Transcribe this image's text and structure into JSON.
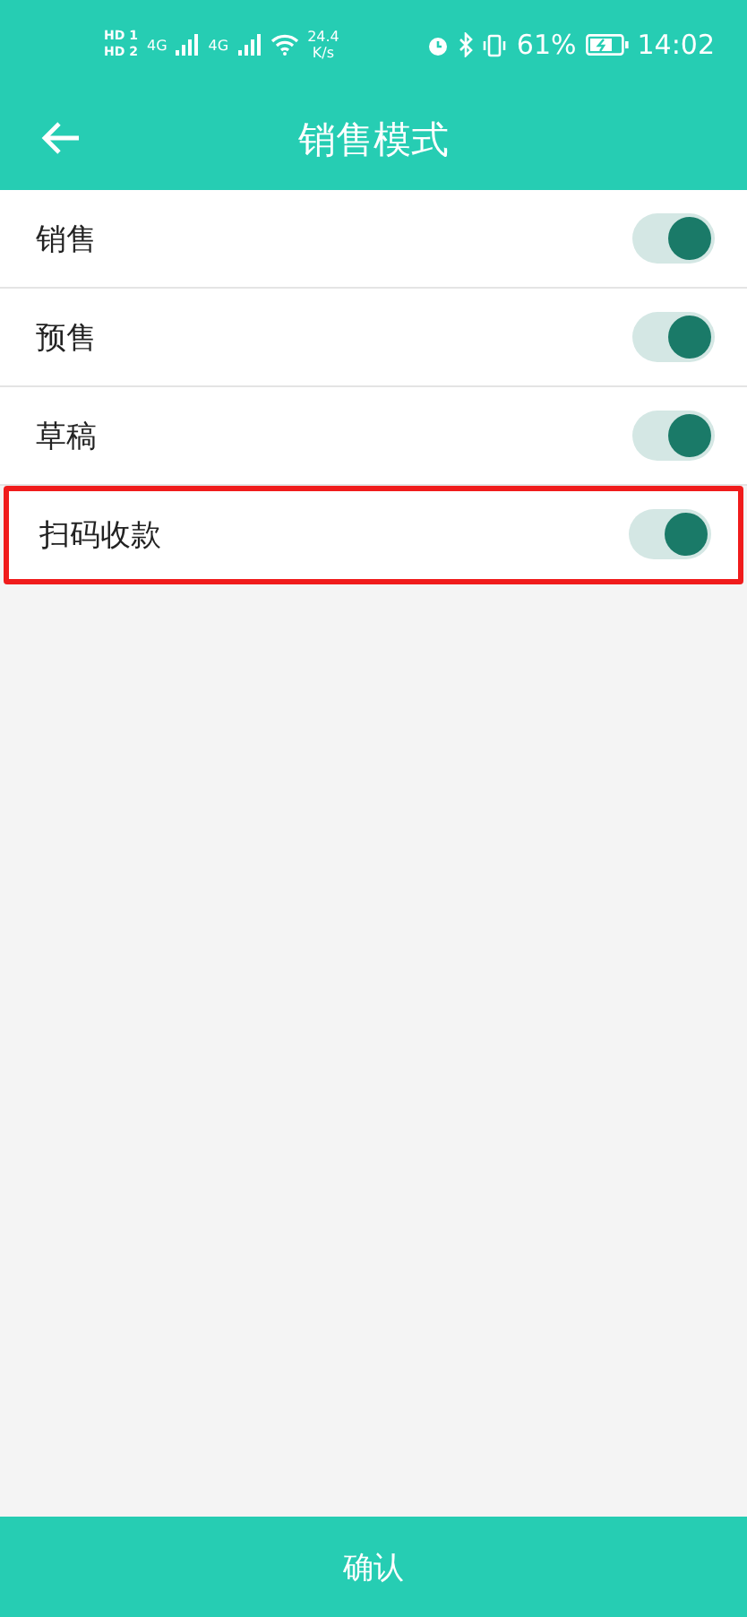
{
  "status_bar": {
    "sim_labels": [
      "HD",
      "HD"
    ],
    "sim_numbers": [
      "1",
      "2"
    ],
    "network": [
      "4G",
      "4G"
    ],
    "speed_value": "24.4",
    "speed_unit": "K/s",
    "battery": "61%",
    "time": "14:02"
  },
  "header": {
    "title": "销售模式"
  },
  "modes": [
    {
      "label": "销售",
      "on": true,
      "highlighted": false
    },
    {
      "label": "预售",
      "on": true,
      "highlighted": false
    },
    {
      "label": "草稿",
      "on": true,
      "highlighted": false
    },
    {
      "label": "扫码收款",
      "on": true,
      "highlighted": true
    }
  ],
  "confirm_button": "确认"
}
